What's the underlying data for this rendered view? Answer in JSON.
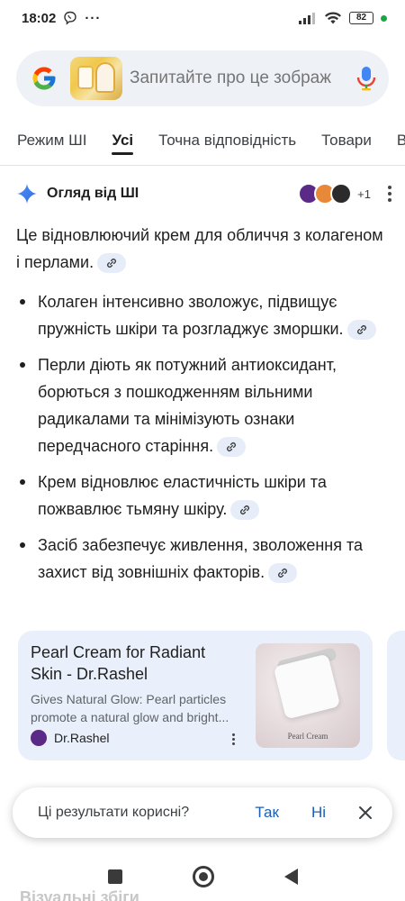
{
  "status_bar": {
    "time": "18:02",
    "viber_icon": "viber-icon",
    "more": "···",
    "battery": "82"
  },
  "search": {
    "placeholder": "Запитайте про це зображ"
  },
  "tabs": [
    {
      "label": "Режим ШІ"
    },
    {
      "label": "Усі",
      "active": true
    },
    {
      "label": "Точна відповідність"
    },
    {
      "label": "Товари"
    },
    {
      "label": "Ві"
    }
  ],
  "ai_overview": {
    "title": "Огляд від ШІ",
    "source_count": "+1",
    "intro": "Це відновлюючий крем для обличчя з колагеном і перлами.",
    "bullets": [
      "Колаген інтенсивно зволожує, підвищує пружність шкіри та розгладжує зморшки.",
      "Перли діють як потужний антиоксидант, борються з пошкодженням вільними радикалами та мінімізують ознаки передчасного старіння.",
      "Крем відновлює еластичність шкіри та пожвавлює тьмяну шкіру.",
      "Засіб забезпечує живлення, зволоження та захист від зовнішніх факторів."
    ]
  },
  "card": {
    "title": "Pearl Cream for Radiant Skin - Dr.Rashel",
    "snippet": "Gives Natural Glow: Pearl particles promote a natural glow and bright...",
    "source": "Dr.Rashel",
    "image_caption": "Pearl Cream"
  },
  "feedback": {
    "question": "Ці результати корисні?",
    "yes": "Так",
    "no": "Ні"
  },
  "below": {
    "text": "Візуальні збіги"
  },
  "colors": {
    "accent": "#1a5fb4",
    "search_bg": "#eef2f7",
    "card_bg": "#eaf0fb"
  }
}
